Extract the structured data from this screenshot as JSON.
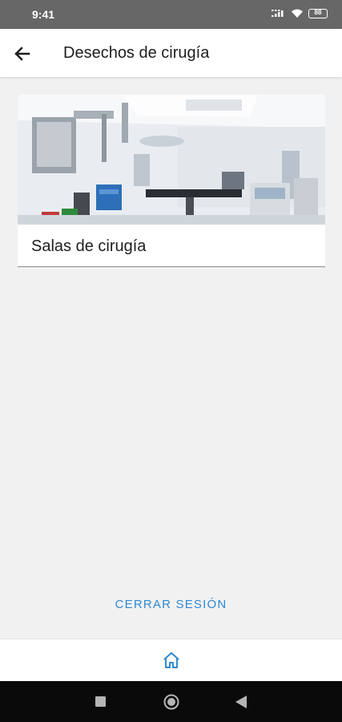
{
  "status_bar": {
    "time": "9:41",
    "battery_level": "88",
    "icons": [
      "signal-icon",
      "wifi-icon",
      "battery-icon"
    ]
  },
  "app_bar": {
    "title": "Desechos de cirugía",
    "back_icon": "arrow-left-icon"
  },
  "cards": [
    {
      "title": "Salas de cirugía",
      "image": "operating-room-photo"
    }
  ],
  "logout_label": "CERRAR SESIÓN",
  "bottom_nav": {
    "items": [
      {
        "icon": "home-icon",
        "selected": true
      }
    ]
  },
  "system_nav": {
    "buttons": [
      "recents-icon",
      "home-circle-icon",
      "back-triangle-icon"
    ]
  },
  "colors": {
    "accent": "#2f8ad0",
    "background": "#f1f1f1",
    "status_bar": "#676767",
    "system_nav": "#0a0a0a"
  }
}
